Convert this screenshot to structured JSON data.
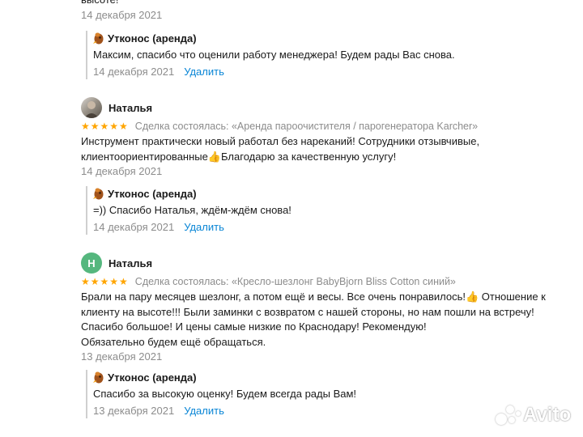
{
  "top": {
    "cut_text": "высоте!",
    "date": "14 декабря 2021"
  },
  "replies_common": {
    "author": "Утконос (аренда)",
    "delete_label": "Удалить",
    "icon": "platypus-logo-icon"
  },
  "reply1": {
    "text": "Максим, спасибо что оценили работу менеджера! Будем рады Вас снова.",
    "date": "14 декабря 2021"
  },
  "review2": {
    "author": "Наталья",
    "stars": "★★★★★",
    "rating": 5,
    "deal": "Сделка состоялась: «Аренда пароочистителя / парогенератора Karcher»",
    "lines": [
      "Инструмент практически новый работал без нареканий! Сотрудники отзывчивые,",
      "клиентоориентированные👍Благодарю за качественную услугу!"
    ],
    "date": "14 декабря 2021"
  },
  "reply2": {
    "text": "=)) Спасибо Наталья, ждём-ждём снова!",
    "date": "14 декабря 2021"
  },
  "review3": {
    "author": "Наталья",
    "avatar_letter": "Н",
    "stars": "★★★★★",
    "rating": 5,
    "deal": "Сделка состоялась: «Кресло-шезлонг BabyBjorn Bliss Cotton синий»",
    "lines": [
      "Брали на пару месяцев шезлонг, а потом ещё и весы. Все очень понравилось!👍 Отношение к",
      "клиенту на высоте!!! Были заминки с возвратом с нашей стороны, но нам пошли на встречу!",
      "Спасибо большое! И цены самые низкие по Краснодару! Рекомендую!",
      "Обязательно будем ещё обращаться."
    ],
    "date": "13 декабря 2021"
  },
  "reply3": {
    "text": "Спасибо за высокую оценку! Будем всегда рады Вам!",
    "date": "13 декабря 2021"
  },
  "watermark": {
    "text": "Avito"
  },
  "colors": {
    "link": "#0a86d6",
    "meta": "#8c8c8c",
    "star": "#ffa500",
    "avatar_green": "#55b77e"
  }
}
